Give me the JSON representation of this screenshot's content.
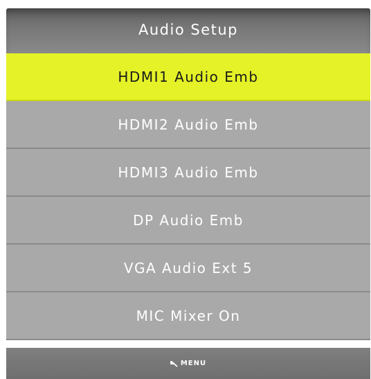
{
  "header": {
    "title": "Audio Setup"
  },
  "menu": {
    "items": [
      {
        "label": "HDMI1 Audio Emb",
        "selected": true
      },
      {
        "label": "HDMI2 Audio Emb",
        "selected": false
      },
      {
        "label": "HDMI3 Audio Emb",
        "selected": false
      },
      {
        "label": "DP Audio Emb",
        "selected": false
      },
      {
        "label": "VGA Audio Ext 5",
        "selected": false
      },
      {
        "label": "MIC Mixer On",
        "selected": false
      }
    ]
  },
  "footer": {
    "label": "MENU",
    "icon": "return-arrow-icon"
  },
  "colors": {
    "highlight": "#e4f227",
    "item_bg": "#a9a9a9",
    "header_bg": "#767676"
  }
}
